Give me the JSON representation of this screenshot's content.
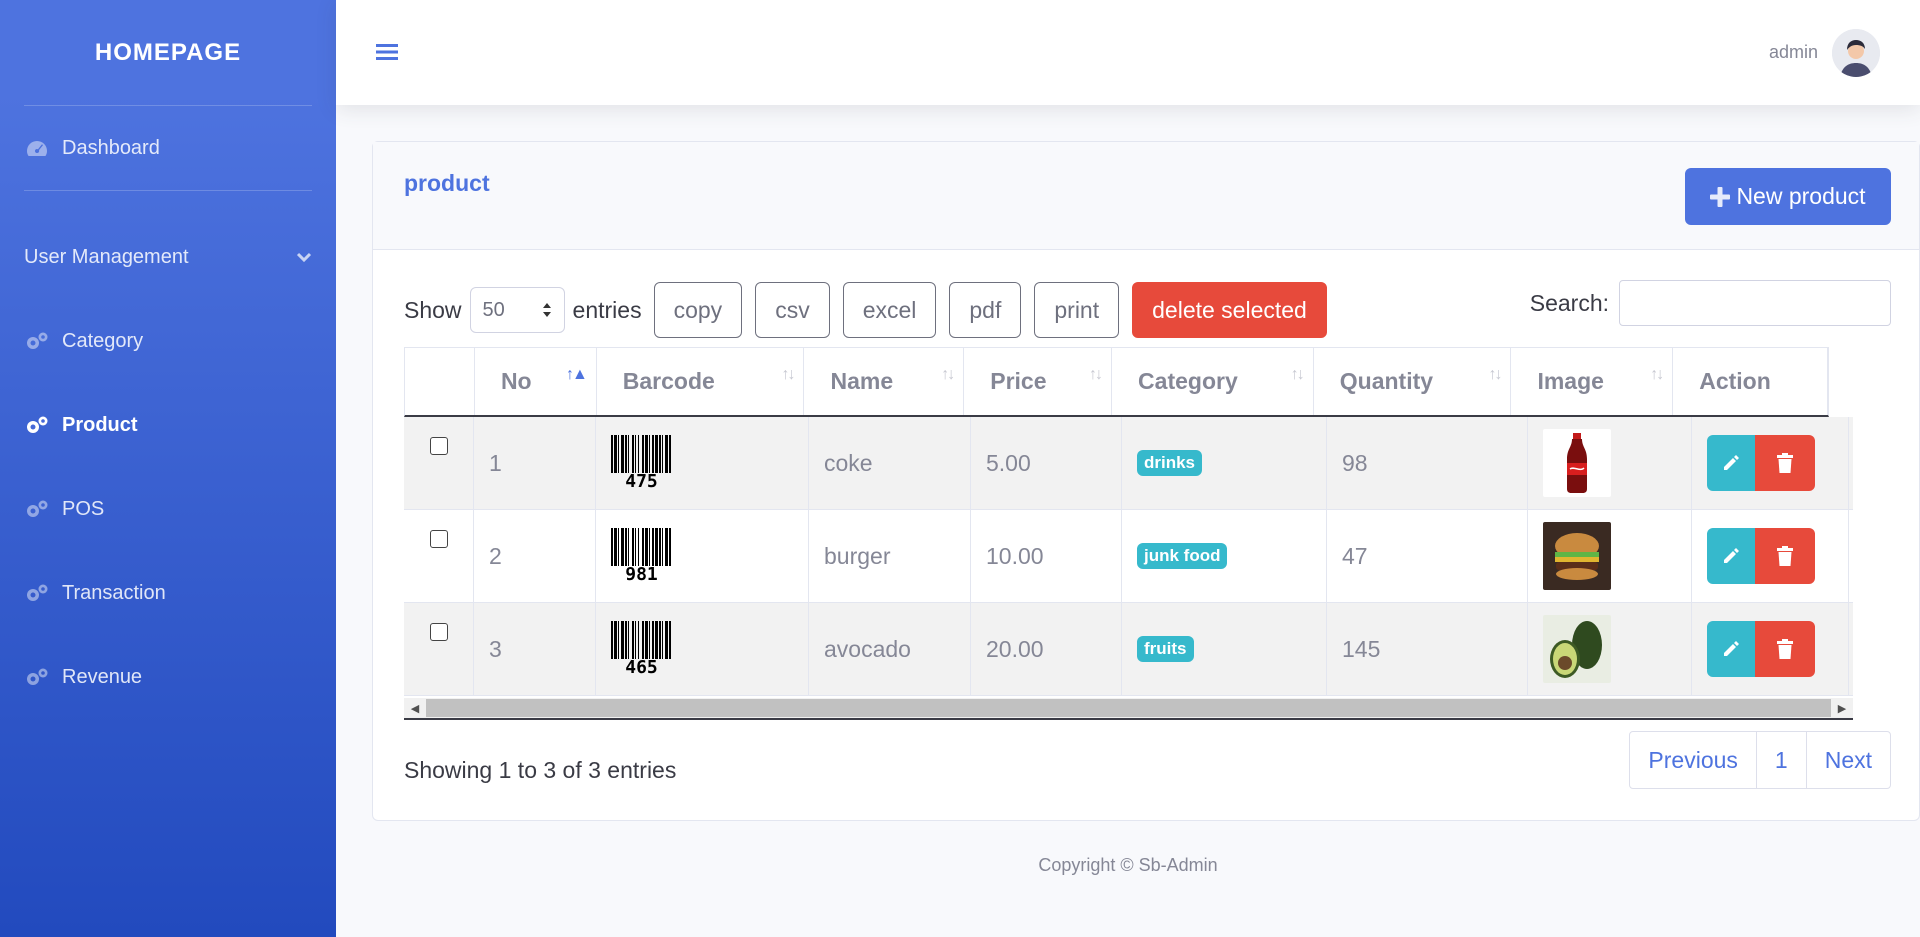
{
  "sidebar": {
    "brand": "HOMEPAGE",
    "items": [
      {
        "label": "Dashboard"
      },
      {
        "label": "User Management"
      },
      {
        "label": "Category"
      },
      {
        "label": "Product"
      },
      {
        "label": "POS"
      },
      {
        "label": "Transaction"
      },
      {
        "label": "Revenue"
      }
    ],
    "active": "Product"
  },
  "topbar": {
    "username": "admin"
  },
  "card": {
    "title": "product",
    "new_button": "New product"
  },
  "toolbar": {
    "show_label": "Show",
    "entries_value": "50",
    "entries_label": "entries",
    "buttons": [
      "copy",
      "csv",
      "excel",
      "pdf",
      "print"
    ],
    "delete_label": "delete selected",
    "search_label": "Search:",
    "search_value": ""
  },
  "table": {
    "columns": [
      "No",
      "Barcode",
      "Name",
      "Price",
      "Category",
      "Quantity",
      "Image",
      "Action"
    ],
    "rows": [
      {
        "no": "1",
        "barcode": "475",
        "name": "coke",
        "price": "5.00",
        "category": "drinks",
        "quantity": "98",
        "image": "coke bottle"
      },
      {
        "no": "2",
        "barcode": "981",
        "name": "burger",
        "price": "10.00",
        "category": "junk food",
        "quantity": "47",
        "image": "burger"
      },
      {
        "no": "3",
        "barcode": "465",
        "name": "avocado",
        "price": "20.00",
        "category": "fruits",
        "quantity": "145",
        "image": "avocado"
      }
    ]
  },
  "info": "Showing 1 to 3 of 3 entries",
  "pagination": {
    "previous": "Previous",
    "page": "1",
    "next": "Next"
  },
  "footer": "Copyright © Sb-Admin",
  "colors": {
    "primary": "#4e73df",
    "info": "#36b9cc",
    "danger": "#e74a3b"
  }
}
